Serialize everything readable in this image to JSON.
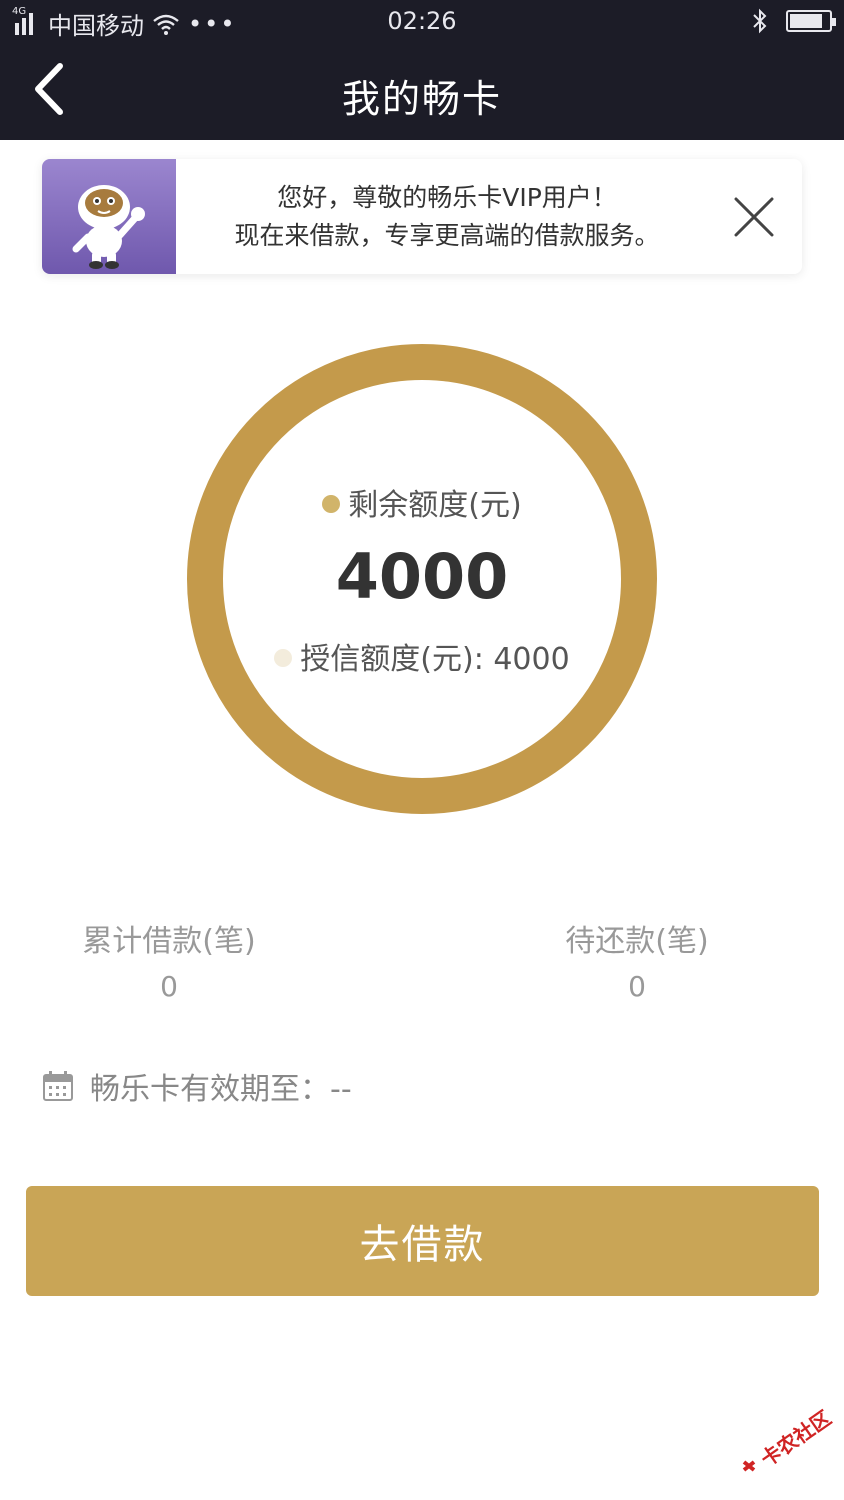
{
  "status_bar": {
    "network": "4G",
    "carrier": "中国移动",
    "time": "02:26",
    "battery_level": 0.76
  },
  "nav": {
    "title": "我的畅卡"
  },
  "banner": {
    "line1": "您好，尊敬的畅乐卡VIP用户！",
    "line2": "现在来借款，专享更高端的借款服务。"
  },
  "ring": {
    "remaining_label": "剩余额度(元)",
    "remaining_value": "4000",
    "credit_label": "授信额度(元): 4000",
    "remaining_dot_color": "#d1b46a",
    "credit_dot_color": "#f3ecdc",
    "ring_color": "#c49a4b"
  },
  "stats": [
    {
      "label": "累计借款(笔)",
      "value": "0"
    },
    {
      "label": "待还款(笔)",
      "value": "0"
    }
  ],
  "expiry": {
    "text": "畅乐卡有效期至：--"
  },
  "cta": {
    "label": "去借款",
    "color": "#c9a556"
  },
  "watermark": {
    "text": "卡农社区"
  }
}
